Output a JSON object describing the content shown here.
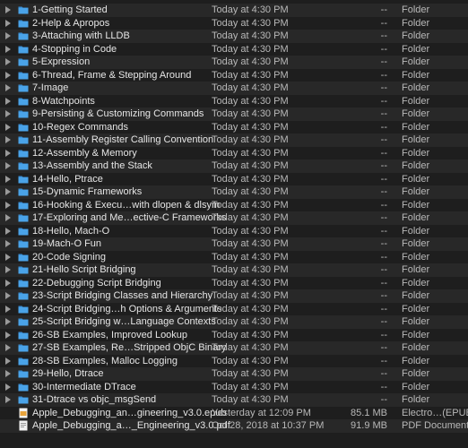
{
  "rows": [
    {
      "name": "1-Getting Started",
      "date": "Today at 4:30 PM",
      "size": "--",
      "kind": "Folder",
      "type": "folder"
    },
    {
      "name": "2-Help & Apropos",
      "date": "Today at 4:30 PM",
      "size": "--",
      "kind": "Folder",
      "type": "folder"
    },
    {
      "name": "3-Attaching with LLDB",
      "date": "Today at 4:30 PM",
      "size": "--",
      "kind": "Folder",
      "type": "folder"
    },
    {
      "name": "4-Stopping in Code",
      "date": "Today at 4:30 PM",
      "size": "--",
      "kind": "Folder",
      "type": "folder"
    },
    {
      "name": "5-Expression",
      "date": "Today at 4:30 PM",
      "size": "--",
      "kind": "Folder",
      "type": "folder"
    },
    {
      "name": "6-Thread, Frame & Stepping Around",
      "date": "Today at 4:30 PM",
      "size": "--",
      "kind": "Folder",
      "type": "folder"
    },
    {
      "name": "7-Image",
      "date": "Today at 4:30 PM",
      "size": "--",
      "kind": "Folder",
      "type": "folder"
    },
    {
      "name": "8-Watchpoints",
      "date": "Today at 4:30 PM",
      "size": "--",
      "kind": "Folder",
      "type": "folder"
    },
    {
      "name": "9-Persisting & Customizing Commands",
      "date": "Today at 4:30 PM",
      "size": "--",
      "kind": "Folder",
      "type": "folder"
    },
    {
      "name": "10-Regex Commands",
      "date": "Today at 4:30 PM",
      "size": "--",
      "kind": "Folder",
      "type": "folder"
    },
    {
      "name": "11-Assembly Register Calling Convention",
      "date": "Today at 4:30 PM",
      "size": "--",
      "kind": "Folder",
      "type": "folder"
    },
    {
      "name": "12-Assembly & Memory",
      "date": "Today at 4:30 PM",
      "size": "--",
      "kind": "Folder",
      "type": "folder"
    },
    {
      "name": "13-Assembly and the Stack",
      "date": "Today at 4:30 PM",
      "size": "--",
      "kind": "Folder",
      "type": "folder"
    },
    {
      "name": "14-Hello, Ptrace",
      "date": "Today at 4:30 PM",
      "size": "--",
      "kind": "Folder",
      "type": "folder"
    },
    {
      "name": "15-Dynamic Frameworks",
      "date": "Today at 4:30 PM",
      "size": "--",
      "kind": "Folder",
      "type": "folder"
    },
    {
      "name": "16-Hooking & Execu…with dlopen & dlsym",
      "date": "Today at 4:30 PM",
      "size": "--",
      "kind": "Folder",
      "type": "folder"
    },
    {
      "name": "17-Exploring and Me…ective-C Frameworks",
      "date": "Today at 4:30 PM",
      "size": "--",
      "kind": "Folder",
      "type": "folder"
    },
    {
      "name": "18-Hello, Mach-O",
      "date": "Today at 4:30 PM",
      "size": "--",
      "kind": "Folder",
      "type": "folder"
    },
    {
      "name": "19-Mach-O Fun",
      "date": "Today at 4:30 PM",
      "size": "--",
      "kind": "Folder",
      "type": "folder"
    },
    {
      "name": "20-Code Signing",
      "date": "Today at 4:30 PM",
      "size": "--",
      "kind": "Folder",
      "type": "folder"
    },
    {
      "name": "21-Hello Script Bridging",
      "date": "Today at 4:30 PM",
      "size": "--",
      "kind": "Folder",
      "type": "folder"
    },
    {
      "name": "22-Debugging Script Bridging",
      "date": "Today at 4:30 PM",
      "size": "--",
      "kind": "Folder",
      "type": "folder"
    },
    {
      "name": "23-Script Bridging Classes and Hierarchy",
      "date": "Today at 4:30 PM",
      "size": "--",
      "kind": "Folder",
      "type": "folder"
    },
    {
      "name": "24-Script Bridging…h Options & Arguments",
      "date": "Today at 4:30 PM",
      "size": "--",
      "kind": "Folder",
      "type": "folder"
    },
    {
      "name": "25-Script Bridging w…Language Contexts",
      "date": "Today at 4:30 PM",
      "size": "--",
      "kind": "Folder",
      "type": "folder"
    },
    {
      "name": "26-SB Examples, Improved Lookup",
      "date": "Today at 4:30 PM",
      "size": "--",
      "kind": "Folder",
      "type": "folder"
    },
    {
      "name": "27-SB Examples, Re…Stripped ObjC Binary",
      "date": "Today at 4:30 PM",
      "size": "--",
      "kind": "Folder",
      "type": "folder"
    },
    {
      "name": "28-SB Examples, Malloc Logging",
      "date": "Today at 4:30 PM",
      "size": "--",
      "kind": "Folder",
      "type": "folder"
    },
    {
      "name": "29-Hello, Dtrace",
      "date": "Today at 4:30 PM",
      "size": "--",
      "kind": "Folder",
      "type": "folder"
    },
    {
      "name": "30-Intermediate DTrace",
      "date": "Today at 4:30 PM",
      "size": "--",
      "kind": "Folder",
      "type": "folder"
    },
    {
      "name": "31-Dtrace vs objc_msgSend",
      "date": "Today at 4:30 PM",
      "size": "--",
      "kind": "Folder",
      "type": "folder"
    },
    {
      "name": "Apple_Debugging_an…gineering_v3.0.epub",
      "date": "Yesterday at 12:09 PM",
      "size": "85.1 MB",
      "kind": "Electro…(EPUB)",
      "type": "epub"
    },
    {
      "name": "Apple_Debugging_a…_Engineering_v3.0.pdf",
      "date": "Oct 28, 2018 at 10:37 PM",
      "size": "91.9 MB",
      "kind": "PDF Document",
      "type": "pdf"
    }
  ],
  "colors": {
    "folder": "#4aa3e8",
    "folder_tab": "#3a8fd6",
    "epub": "#e8a33a",
    "pdf": "#d9d9d9"
  }
}
